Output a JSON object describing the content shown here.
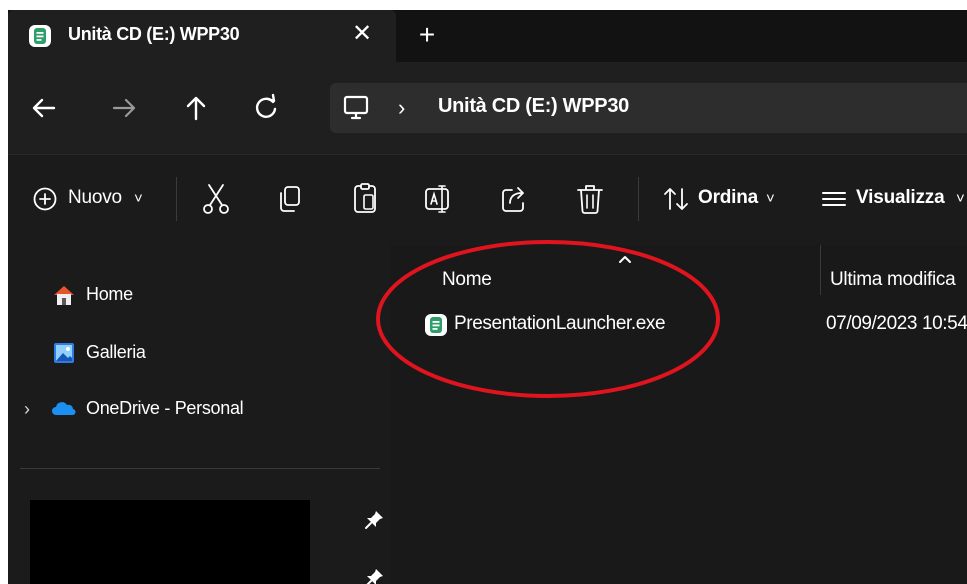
{
  "tab": {
    "title": "Unità CD (E:) WPP30",
    "close_glyph": "✕",
    "new_tab_glyph": "+",
    "icon": "drive-app-icon"
  },
  "nav": {
    "back_icon": "arrow-left-icon",
    "forward_icon": "arrow-right-icon",
    "up_icon": "arrow-up-icon",
    "refresh_icon": "refresh-icon"
  },
  "address": {
    "root_icon": "this-pc-icon",
    "separator": "›",
    "path": "Unità CD (E:) WPP30"
  },
  "commands": {
    "new_label": "Nuovo",
    "sort_label": "Ordina",
    "view_label": "Visualizza",
    "dropdown_glyph": "˅",
    "icons": [
      "cut-icon",
      "copy-icon",
      "paste-icon",
      "rename-icon",
      "share-icon",
      "delete-icon"
    ]
  },
  "sidebar": {
    "items": [
      {
        "label": "Home",
        "icon": "home-icon"
      },
      {
        "label": "Galleria",
        "icon": "gallery-icon"
      },
      {
        "label": "OneDrive - Personal",
        "icon": "onedrive-icon",
        "expandable": true
      }
    ],
    "expand_glyph": "›"
  },
  "list": {
    "columns": [
      "Nome",
      "Ultima modifica"
    ],
    "rows": [
      {
        "name": "PresentationLauncher.exe",
        "modified": "07/09/2023 10:54",
        "icon": "exe-app-icon"
      }
    ]
  },
  "colors": {
    "window_bg": "#1b1b1b",
    "tabstrip_bg": "#121212",
    "annotation": "#e0141e",
    "app_icon_green": "#2e9e6a"
  }
}
